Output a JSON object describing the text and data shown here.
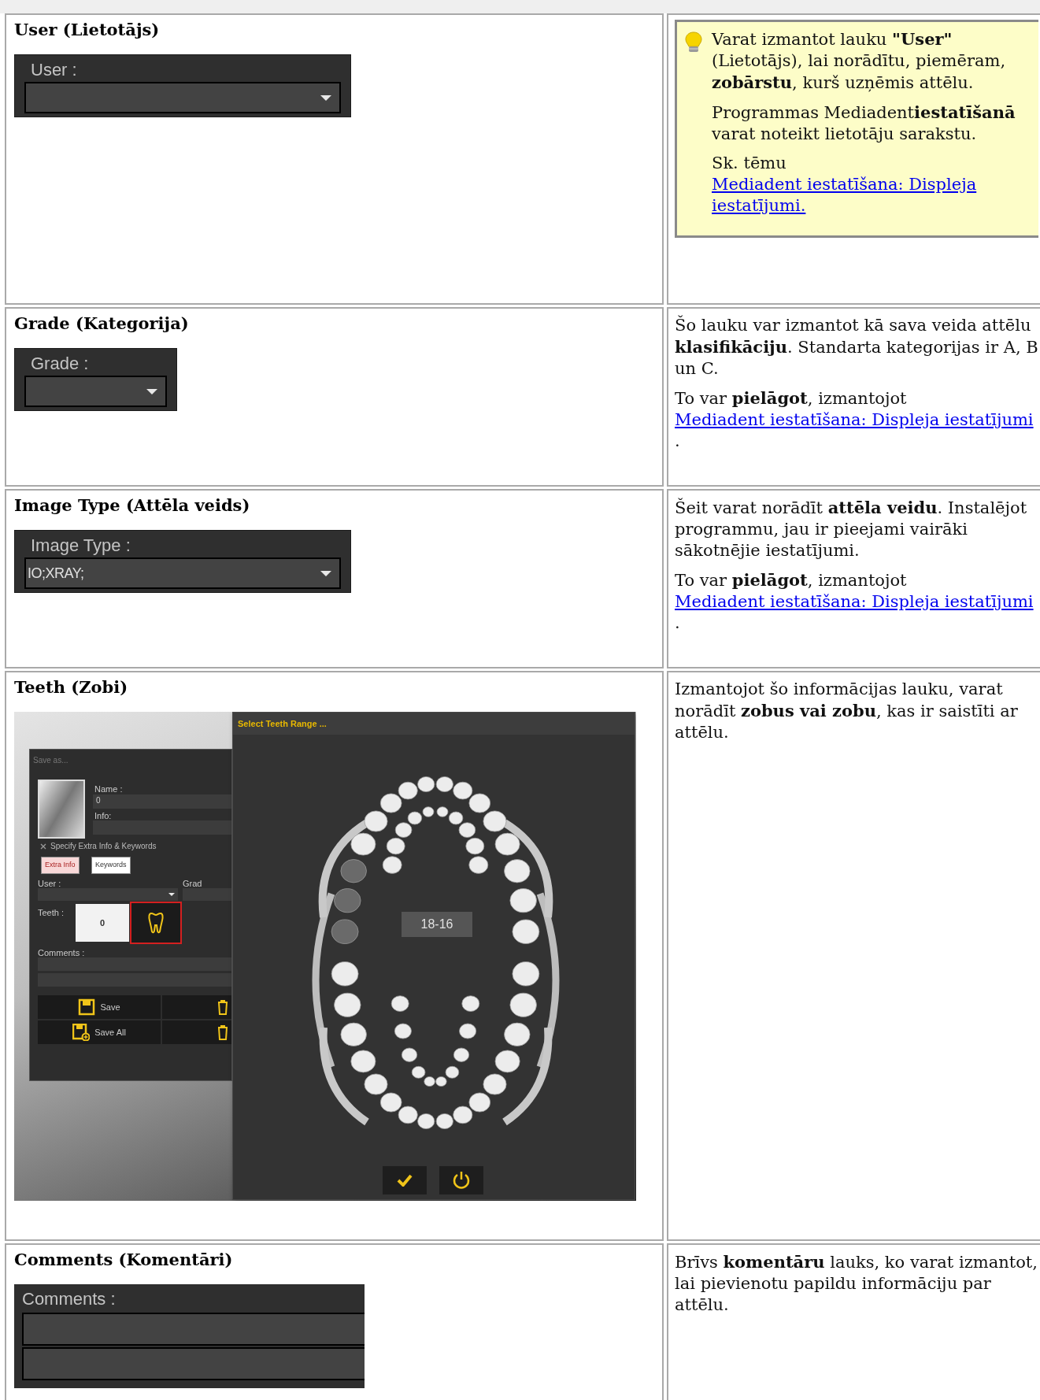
{
  "rows": [
    {
      "title": "User (Lietotājs)",
      "widget": {
        "kind": "dropdown",
        "label": "User :"
      },
      "description": {
        "kind": "tip",
        "paragraphs": [
          {
            "text": "Varat izmantot lauku **\"User\"** (Lietotājs), lai norādītu, piemēram, **zobārstu**, kurš uzņēmis attēlu."
          },
          {
            "text": "Programmas Mediadent**iestatīšanā** varat noteikt lietotāju sarakstu."
          },
          {
            "text": "Sk. tēmu ",
            "link": "Mediadent iestatīšana: Displeja iestatījumi."
          }
        ]
      }
    },
    {
      "title": "Grade (Kategorija)",
      "widget": {
        "kind": "dropdown",
        "label": "Grade :"
      },
      "description": {
        "kind": "plain",
        "paragraphs": [
          {
            "text": "Šo lauku var izmantot kā sava veida attēlu **klasifikāciju**. Standarta kategorijas ir A, B un C."
          },
          {
            "text": "To var **pielāgot**, izmantojot ",
            "link": "Mediadent iestatīšana: Displeja iestatījumi",
            "after": "."
          }
        ]
      }
    },
    {
      "title": "Image Type (Attēla veids)",
      "widget": {
        "kind": "dropdown",
        "label": "Image Type :",
        "value": "IO;XRAY;"
      },
      "description": {
        "kind": "plain",
        "paragraphs": [
          {
            "text": "Šeit varat norādīt **attēla veidu**. Instalējot programmu, jau ir pieejami vairāki sākotnējie iestatījumi."
          },
          {
            "text": "To var **pielāgot**, izmantojot ",
            "link": "Mediadent iestatīšana: Displeja iestatījumi",
            "after": "."
          }
        ]
      }
    },
    {
      "title": "Teeth (Zobi)",
      "widget": {
        "kind": "teeth_screenshot",
        "save_dialog": {
          "title": "Save as...",
          "name_label": "Name :",
          "name_value": "0",
          "info_label": "Info:",
          "extra_toggle": "Specify Extra Info & Keywords",
          "tabs": [
            {
              "label": "Extra Info",
              "selected": true
            },
            {
              "label": "Keywords",
              "selected": false
            }
          ],
          "user_label": "User :",
          "grade_label": "Grad",
          "teeth_label": "Teeth :",
          "teeth_value": "0",
          "comments_label": "Comments :",
          "buttons": [
            "Save",
            "Save All"
          ]
        },
        "teeth_window": {
          "title": "Select Teeth Range ...",
          "range": "18-16"
        }
      },
      "description": {
        "kind": "plain",
        "paragraphs": [
          {
            "text": "Izmantojot šo informācijas lauku, varat norādīt **zobus vai zobu**, kas ir saistīti ar attēlu."
          }
        ]
      }
    },
    {
      "title": "Comments (Komentāri)",
      "widget": {
        "kind": "comments",
        "label": "Comments :"
      },
      "description": {
        "kind": "plain",
        "paragraphs": [
          {
            "text": "Brīvs **komentāru** lauks, ko varat izmantot, lai pievienotu papildu informāciju par attēlu."
          }
        ]
      }
    }
  ]
}
